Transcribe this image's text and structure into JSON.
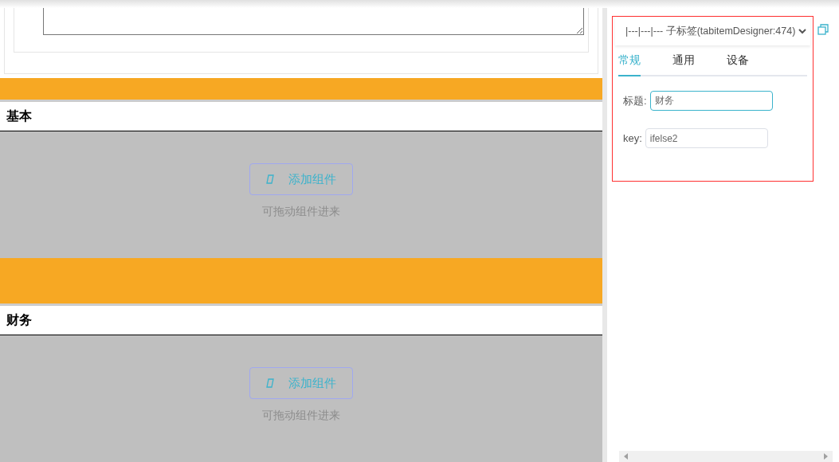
{
  "sections": [
    {
      "title": "基本",
      "add_button": "添加组件",
      "hint": "可拖动组件进来"
    },
    {
      "title": "财务",
      "add_button": "添加组件",
      "hint": "可拖动组件进来"
    }
  ],
  "panel": {
    "selector": "|---|---|--- 子标签(tabitemDesigner:474)",
    "tabs": [
      {
        "label": "常规",
        "selected": true
      },
      {
        "label": "通用",
        "selected": false
      },
      {
        "label": "设备",
        "selected": false
      }
    ],
    "fields": [
      {
        "label": "标题:",
        "value": "财务",
        "focused": true
      },
      {
        "label": "key:",
        "value": "ifelse2",
        "focused": false
      }
    ]
  }
}
